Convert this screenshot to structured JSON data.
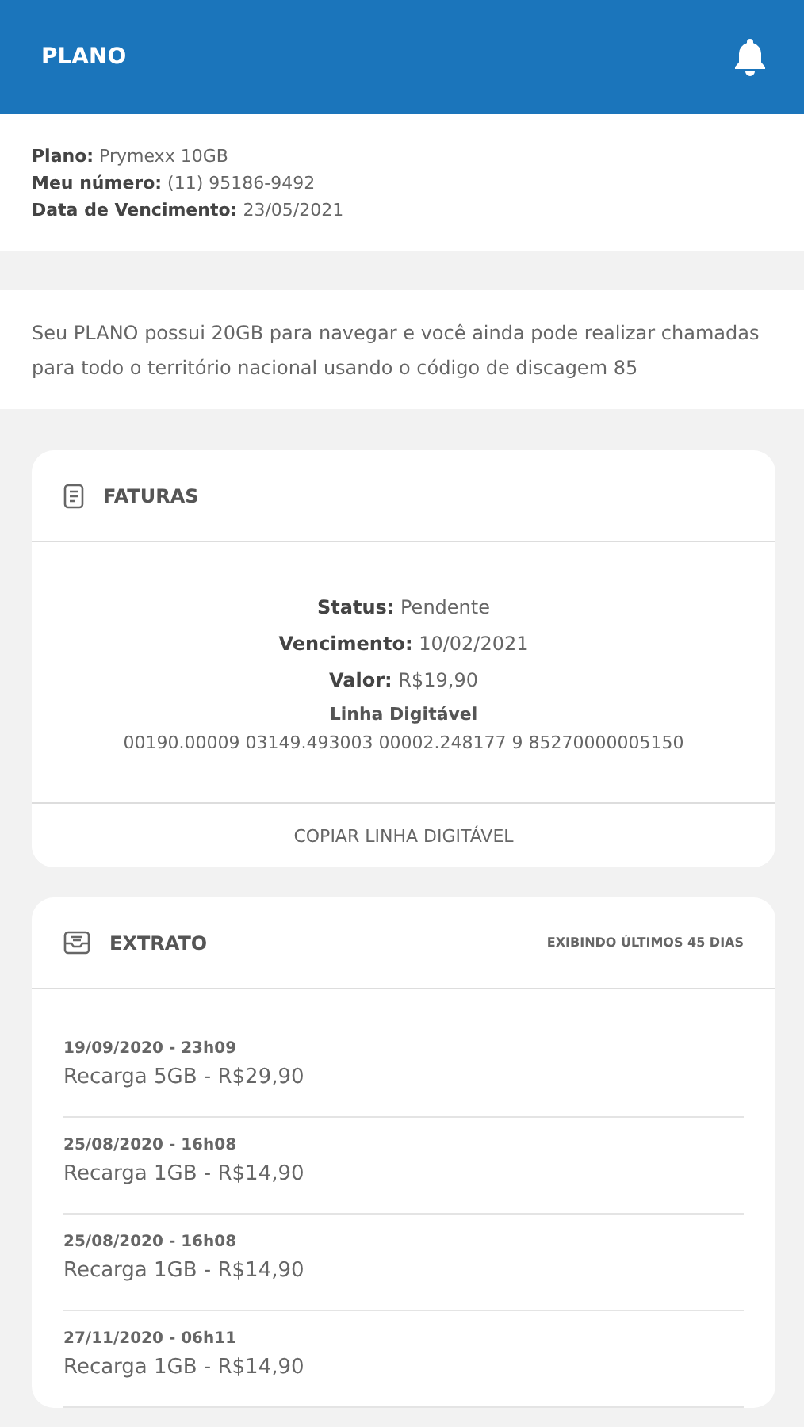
{
  "header": {
    "title": "PLANO"
  },
  "plan_info": [
    "**Plano:** Prymexx 10GB",
    "**Meu número:** (11) 95186-9492",
    "**Data de Vencimento:** 23/05/2021"
  ],
  "description": "Seu PLANO possui 20GB para navegar e você ainda pode realizar chamadas para todo o território nacional usando o código de discagem 85",
  "invoices": {
    "title": "FATURAS",
    "details": [
      "**Status:** Pendente",
      "**Vencimento:** 10/02/2021",
      "**Valor:** R$19,90"
    ],
    "barcode_label": "Linha Digitável",
    "barcode": "00190.00009 03149.493003 00002.248177 9 85270000005150",
    "copy_button": "COPIAR LINHA DIGITÁVEL"
  },
  "statement": {
    "title": "EXTRATO",
    "range": "EXIBINDO ÚLTIMOS 45 DIAS",
    "entries": [
      {
        "datetime": "19/09/2020 - 23h09",
        "description": "Recarga 5GB - R$29,90"
      },
      {
        "datetime": "25/08/2020 - 16h08",
        "description": "Recarga 1GB - R$14,90"
      },
      {
        "datetime": "25/08/2020 - 16h08",
        "description": "Recarga 1GB - R$14,90"
      },
      {
        "datetime": "27/11/2020 - 06h11",
        "description": "Recarga 1GB - R$14,90"
      }
    ]
  }
}
